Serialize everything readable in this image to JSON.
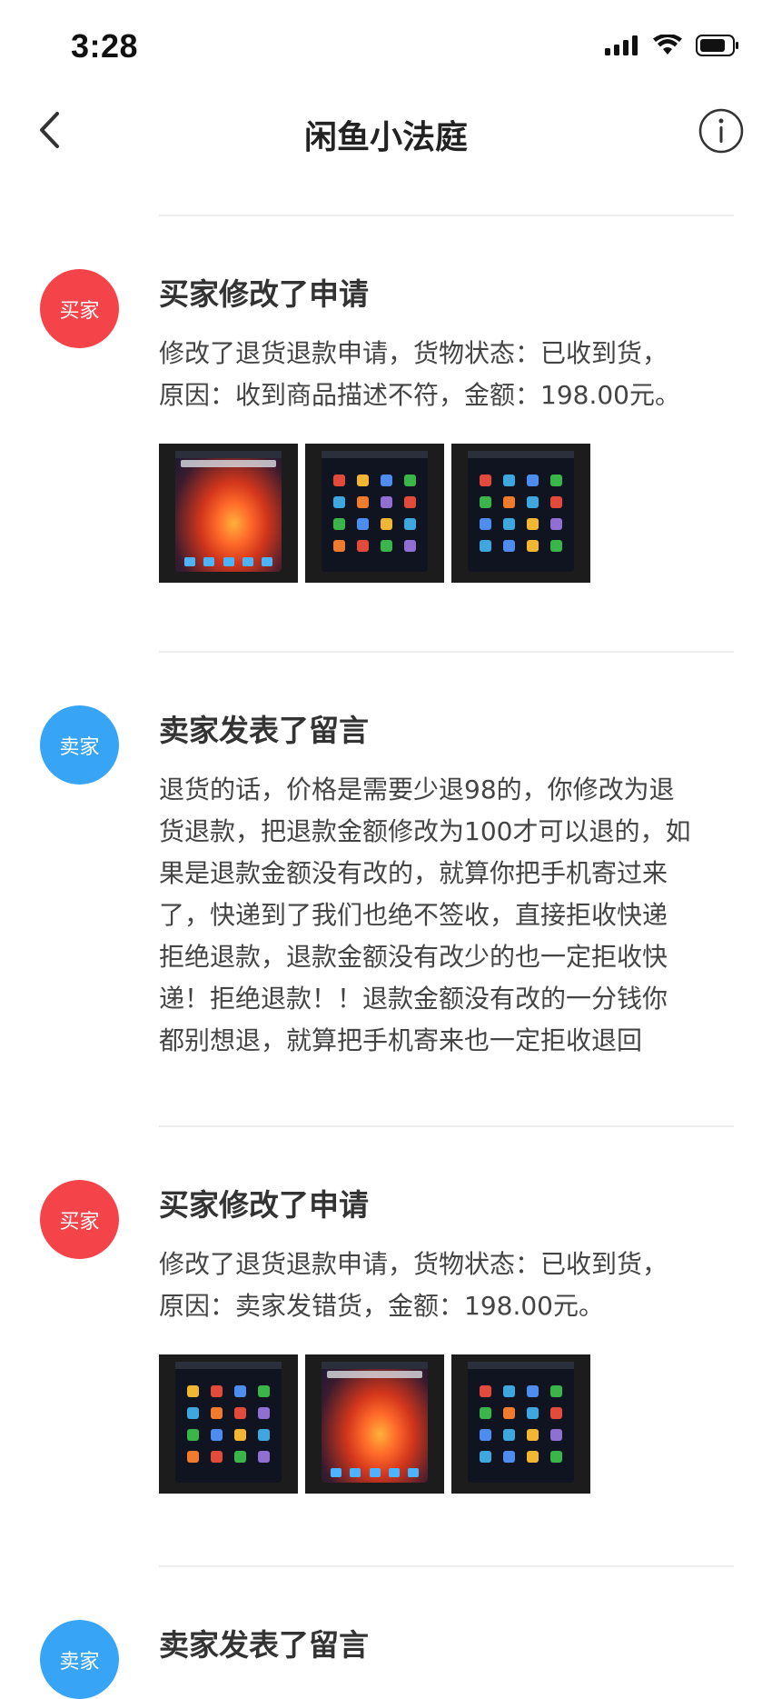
{
  "status_bar": {
    "time": "3:28",
    "icons": [
      "cellular-signal-icon",
      "wifi-icon",
      "battery-icon"
    ]
  },
  "nav": {
    "title": "闲鱼小法庭",
    "back_icon": "chevron-left-icon",
    "info_icon": "info-circle-icon"
  },
  "timeline": [
    {
      "role": "buyer",
      "avatar_label": "买家",
      "title": "买家修改了申请",
      "body": "修改了退货退款申请，货物状态：已收到货，\n原因：收到商品描述不符，金额：198.00元。",
      "images": [
        "wallpaper",
        "apps",
        "apps"
      ]
    },
    {
      "role": "seller",
      "avatar_label": "卖家",
      "title": "卖家发表了留言",
      "body": "退货的话，价格是需要少退98的，你修改为退\n货退款，把退款金额修改为100才可以退的，如\n果是退款金额没有改的，就算你把手机寄过来\n了，快递到了我们也绝不签收，直接拒收快递\n拒绝退款，退款金额没有改少的也一定拒收快\n递！拒绝退款！！退款金额没有改的一分钱你\n都别想退，就算把手机寄来也一定拒收退回",
      "images": []
    },
    {
      "role": "buyer",
      "avatar_label": "买家",
      "title": "买家修改了申请",
      "body": "修改了退货退款申请，货物状态：已收到货，\n原因：卖家发错货，金额：198.00元。",
      "images": [
        "apps",
        "wallpaper",
        "apps"
      ]
    },
    {
      "role": "seller",
      "avatar_label": "卖家",
      "title": "卖家发表了留言",
      "body": "",
      "images": []
    }
  ],
  "colors": {
    "buyer_avatar": "#f5434a",
    "seller_avatar": "#38a4f5",
    "divider": "#ececec"
  }
}
